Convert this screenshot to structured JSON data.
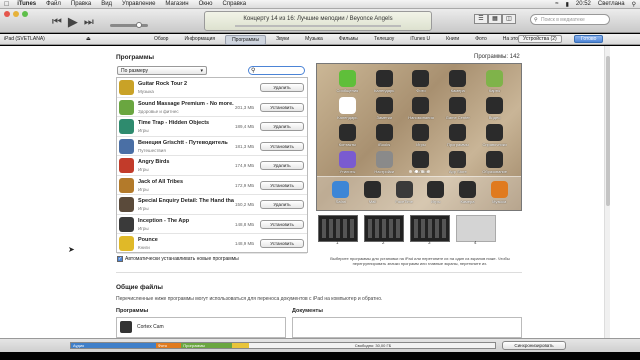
{
  "menubar": {
    "apple": "",
    "items": [
      "iTunes",
      "Файл",
      "Правка",
      "Вид",
      "Управление",
      "Магазин",
      "Окно",
      "Справка"
    ],
    "time": "20:52",
    "user": "Светлана"
  },
  "player": {
    "now_playing_line1": "Концерту 14 из 16: Лучшие мелодии / Beyonce Angels",
    "search_placeholder": "Поиск в медиатеке"
  },
  "device_bar": {
    "device_name": "iPad (SVETLANA)",
    "tabs": [
      "Обзор",
      "Информация",
      "Программы",
      "Звуки",
      "Музыка",
      "Фильмы",
      "Телешоу",
      "iTunes U",
      "Книги",
      "Фото",
      "На этом iPad"
    ],
    "active_tab": "Программы",
    "devices_button": "Устройства (2)",
    "done_button": "Готово"
  },
  "apps_section": {
    "heading": "Программы",
    "count_label": "Программы: 142",
    "sort": "По размеру",
    "apps": [
      {
        "name": "Guitar Rock Tour 2",
        "category": "Музыка",
        "size": "",
        "action": "Удалить",
        "color": "#c9a227"
      },
      {
        "name": "Sound Massage Premium - No more...",
        "category": "Здоровье и фитнес",
        "size": "201,3 МБ",
        "action": "Установить",
        "color": "#6aa640"
      },
      {
        "name": "Time Trap - Hidden Objects",
        "category": "Игры",
        "size": "189,4 МБ",
        "action": "Удалить",
        "color": "#2e8b6e"
      },
      {
        "name": "Венеция Grischtt - Путеводитель",
        "category": "Путешествия",
        "size": "181,3 МБ",
        "action": "Установить",
        "color": "#4a6fa5"
      },
      {
        "name": "Angry Birds",
        "category": "Игры",
        "size": "174,9 МБ",
        "action": "Удалить",
        "color": "#c23b2a"
      },
      {
        "name": "Jack of All Tribes",
        "category": "Игры",
        "size": "172,9 МБ",
        "action": "Установить",
        "color": "#b37a2a"
      },
      {
        "name": "Special Enquiry Detail: The Hand that...",
        "category": "Игры",
        "size": "150,2 МБ",
        "action": "Удалить",
        "color": "#5a4a3a"
      },
      {
        "name": "Inception - The App",
        "category": "Игры",
        "size": "148,8 МБ",
        "action": "Установить",
        "color": "#3a3a3a"
      },
      {
        "name": "Pounce",
        "category": "Книги",
        "size": "148,9 МБ",
        "action": "Установить",
        "color": "#e0b928"
      }
    ],
    "auto_install_label": "Автоматически устанавливать новые программы"
  },
  "home_screen": {
    "icons": [
      {
        "label": "Сообщения",
        "color": "#5fbf3a"
      },
      {
        "label": "Календарь",
        "color": "#2b2b2b"
      },
      {
        "label": "Фото",
        "color": "#2b2b2b"
      },
      {
        "label": "Камера",
        "color": "#2b2b2b"
      },
      {
        "label": "Карты",
        "color": "#7fb34a"
      },
      {
        "label": "Календарь",
        "color": "#ffffff"
      },
      {
        "label": "Заметки",
        "color": "#2b2b2b"
      },
      {
        "label": "Напоминания",
        "color": "#2b2b2b"
      },
      {
        "label": "Game Center",
        "color": "#2b2b2b"
      },
      {
        "label": "Видео",
        "color": "#2b2b2b"
      },
      {
        "label": "Контакты",
        "color": "#2b2b2b"
      },
      {
        "label": "iBooks",
        "color": "#2b2b2b"
      },
      {
        "label": "Игры",
        "color": "#2b2b2b"
      },
      {
        "label": "Программы",
        "color": "#2b2b2b"
      },
      {
        "label": "Справочники",
        "color": "#2b2b2b"
      },
      {
        "label": "Утилиты",
        "color": "#7a5bd0"
      },
      {
        "label": "Настройки",
        "color": "#8a8a8a"
      },
      {
        "label": "YouTube",
        "color": "#2b2b2b"
      },
      {
        "label": "App Store",
        "color": "#2b2b2b"
      },
      {
        "label": "Образование",
        "color": "#2b2b2b"
      }
    ],
    "dock": [
      {
        "label": "Safari",
        "color": "#3d86d6"
      },
      {
        "label": "Mail",
        "color": "#2b2b2b"
      },
      {
        "label": "FaceTime",
        "color": "#3a3a3a"
      },
      {
        "label": "Игры",
        "color": "#2b2b2b"
      },
      {
        "label": "Камера",
        "color": "#2b2b2b"
      },
      {
        "label": "Музыка",
        "color": "#e07a1e"
      }
    ],
    "pages": [
      "1",
      "2",
      "3",
      "4"
    ],
    "hint": "Выберите программы для установки на iPad или перетяните их на один из экранов ниже. Чтобы перегруппировать значки программ или главные экраны, перетяните их."
  },
  "shared_files": {
    "heading": "Общие файлы",
    "description": "Перечисленные ниже программы могут использоваться для переноса документов с iPad на компьютер и обратно.",
    "programs_heading": "Программы",
    "documents_heading": "Документы",
    "first_program": "Cortex Cam"
  },
  "capacity": {
    "segments": [
      {
        "label": "Аудио",
        "fraction": 0.2,
        "color": "#3f7fc9"
      },
      {
        "label": "Фото",
        "fraction": 0.06,
        "color": "#e07a1e"
      },
      {
        "label": "Программы",
        "fraction": 0.12,
        "color": "#6aa640"
      },
      {
        "label": "",
        "fraction": 0.04,
        "color": "#e8c43a"
      }
    ],
    "free_label": "Свободно: 30,00 ГБ",
    "sync_button": "Синхронизировать"
  }
}
